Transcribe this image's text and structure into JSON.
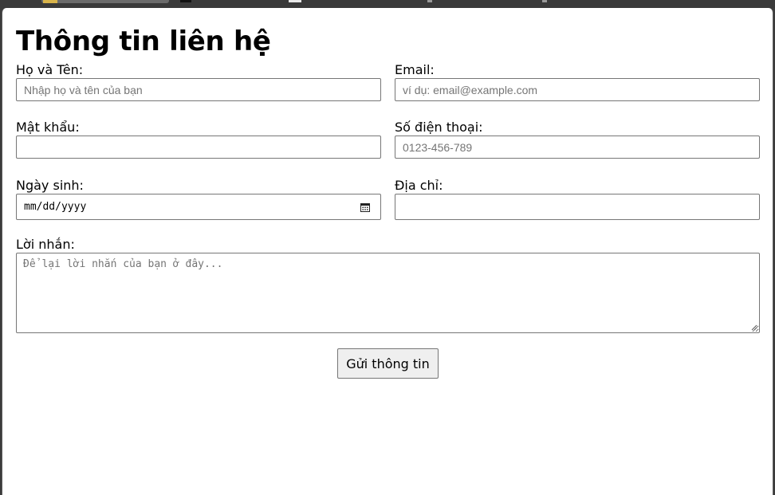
{
  "form": {
    "title": "Thông tin liên hệ",
    "full_name": {
      "label": "Họ và Tên:",
      "placeholder": "Nhập họ và tên của bạn",
      "value": ""
    },
    "email": {
      "label": "Email:",
      "placeholder": "ví dụ: email@example.com",
      "value": ""
    },
    "password": {
      "label": "Mật khẩu:",
      "value": ""
    },
    "phone": {
      "label": "Số điện thoại:",
      "placeholder": "0123-456-789",
      "value": ""
    },
    "dob": {
      "label": "Ngày sinh:",
      "placeholder": "mm/dd/yyyy",
      "icon": "calendar-icon"
    },
    "address": {
      "label": "Địa chỉ:",
      "value": ""
    },
    "message": {
      "label": "Lời nhắn:",
      "placeholder": "Để lại lời nhắn của bạn ở đây..."
    },
    "submit_label": "Gửi thông tin"
  }
}
